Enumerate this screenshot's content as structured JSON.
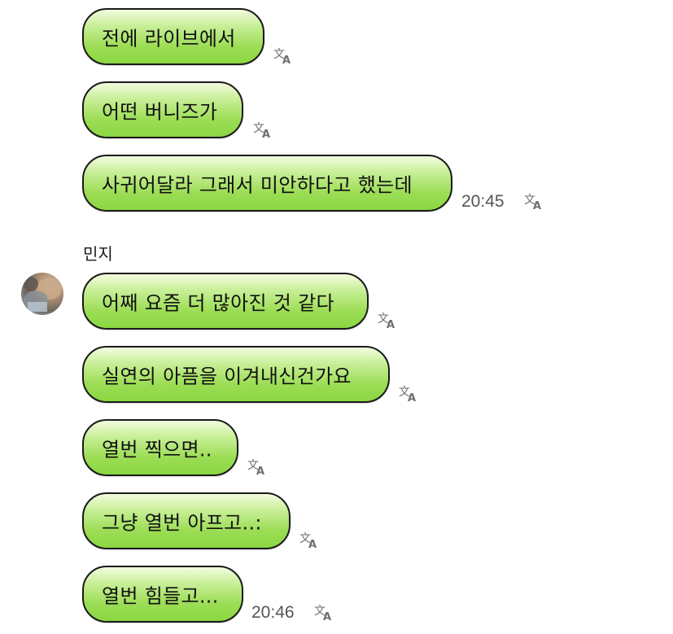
{
  "sent_messages": [
    {
      "text": "전에 라이브에서"
    },
    {
      "text": "어떤 버니즈가"
    },
    {
      "text": "사귀어달라 그래서 미안하다고 했는데",
      "time": "20:45"
    }
  ],
  "contact": {
    "name": "민지"
  },
  "received_messages": [
    {
      "text": "어째 요즘 더 많아진 것 같다"
    },
    {
      "text": "실연의 아픔을 이겨내신건가요"
    },
    {
      "text": "열번 찍으면.."
    },
    {
      "text": "그냥 열번 아프고..:"
    },
    {
      "text": "열번 힘들고...",
      "time": "20:46"
    }
  ],
  "icons": {
    "translate": "translate-icon",
    "avatar": "profile-photo"
  },
  "colors": {
    "bubble_top": "#f2fcdf",
    "bubble_bottom": "#8bd742",
    "bubble_border": "#1a1a1a",
    "timestamp": "#555555"
  }
}
